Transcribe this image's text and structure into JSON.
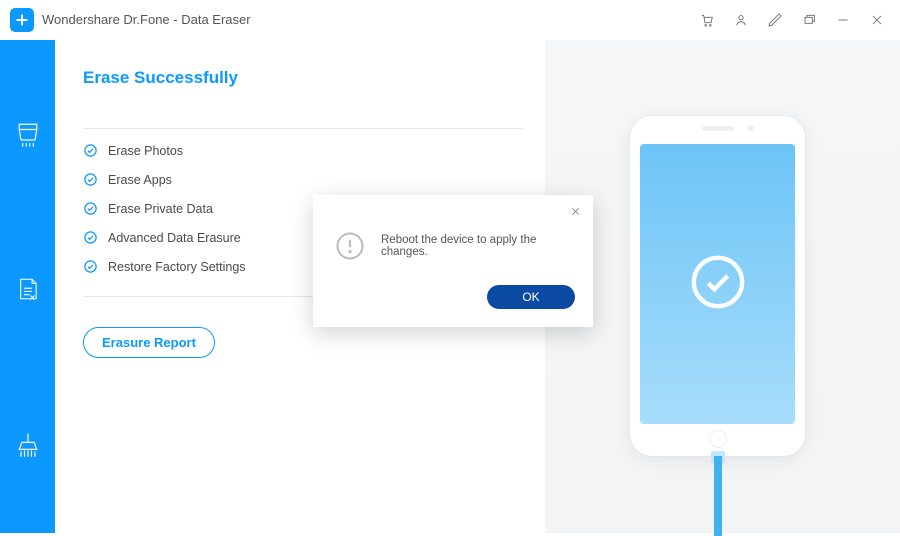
{
  "titlebar": {
    "title": "Wondershare Dr.Fone - Data Eraser"
  },
  "page": {
    "heading": "Erase Successfully",
    "items": [
      {
        "label": "Erase Photos"
      },
      {
        "label": "Erase Apps"
      },
      {
        "label": "Erase Private Data"
      },
      {
        "label": "Advanced Data Erasure"
      },
      {
        "label": "Restore Factory Settings"
      }
    ],
    "report_button": "Erasure Report"
  },
  "dialog": {
    "message": "Reboot the device to apply the changes.",
    "ok": "OK"
  }
}
